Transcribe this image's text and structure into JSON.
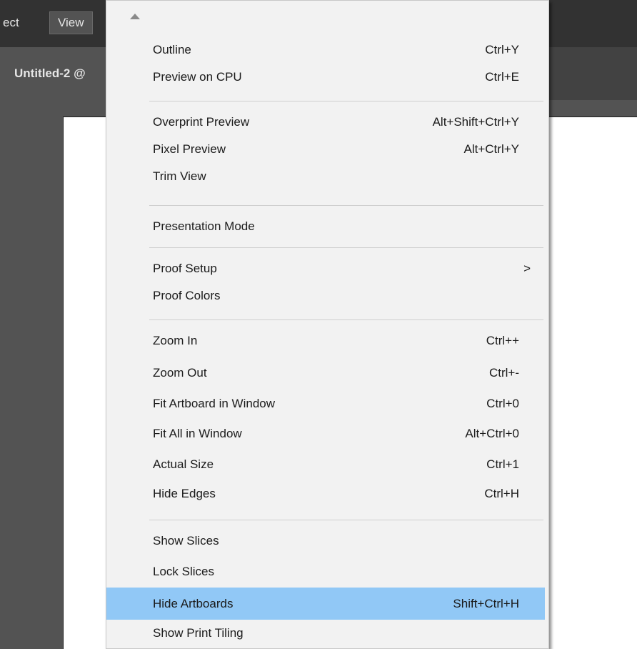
{
  "menubar": {
    "effect_label": "ect",
    "view_label": "View"
  },
  "document": {
    "tab_title": "Untitled-2 @"
  },
  "menu": {
    "items": [
      {
        "label": "Outline",
        "shortcut": "Ctrl+Y"
      },
      {
        "label": "Preview on CPU",
        "shortcut": "Ctrl+E"
      },
      {
        "label": "Overprint Preview",
        "shortcut": "Alt+Shift+Ctrl+Y"
      },
      {
        "label": "Pixel Preview",
        "shortcut": "Alt+Ctrl+Y"
      },
      {
        "label": "Trim View",
        "shortcut": ""
      },
      {
        "label": "Presentation Mode",
        "shortcut": ""
      },
      {
        "label": "Proof Setup",
        "submenu_arrow": ">"
      },
      {
        "label": "Proof Colors",
        "shortcut": ""
      },
      {
        "label": "Zoom In",
        "shortcut": "Ctrl++"
      },
      {
        "label": "Zoom Out",
        "shortcut": "Ctrl+-"
      },
      {
        "label": "Fit Artboard in Window",
        "shortcut": "Ctrl+0"
      },
      {
        "label": "Fit All in Window",
        "shortcut": "Alt+Ctrl+0"
      },
      {
        "label": "Actual Size",
        "shortcut": "Ctrl+1"
      },
      {
        "label": "Hide Edges",
        "shortcut": "Ctrl+H"
      },
      {
        "label": "Show Slices",
        "shortcut": ""
      },
      {
        "label": "Lock Slices",
        "shortcut": ""
      },
      {
        "label": "Hide Artboards",
        "shortcut": "Shift+Ctrl+H"
      },
      {
        "label": "Show Print Tiling",
        "shortcut": ""
      }
    ]
  },
  "colors": {
    "highlight": "#91c8f6",
    "menu_background": "#f2f2f2",
    "app_background": "#323232"
  },
  "icons": {
    "scroll_up": "scroll-up-arrow-icon",
    "submenu": "chevron-right-icon"
  }
}
